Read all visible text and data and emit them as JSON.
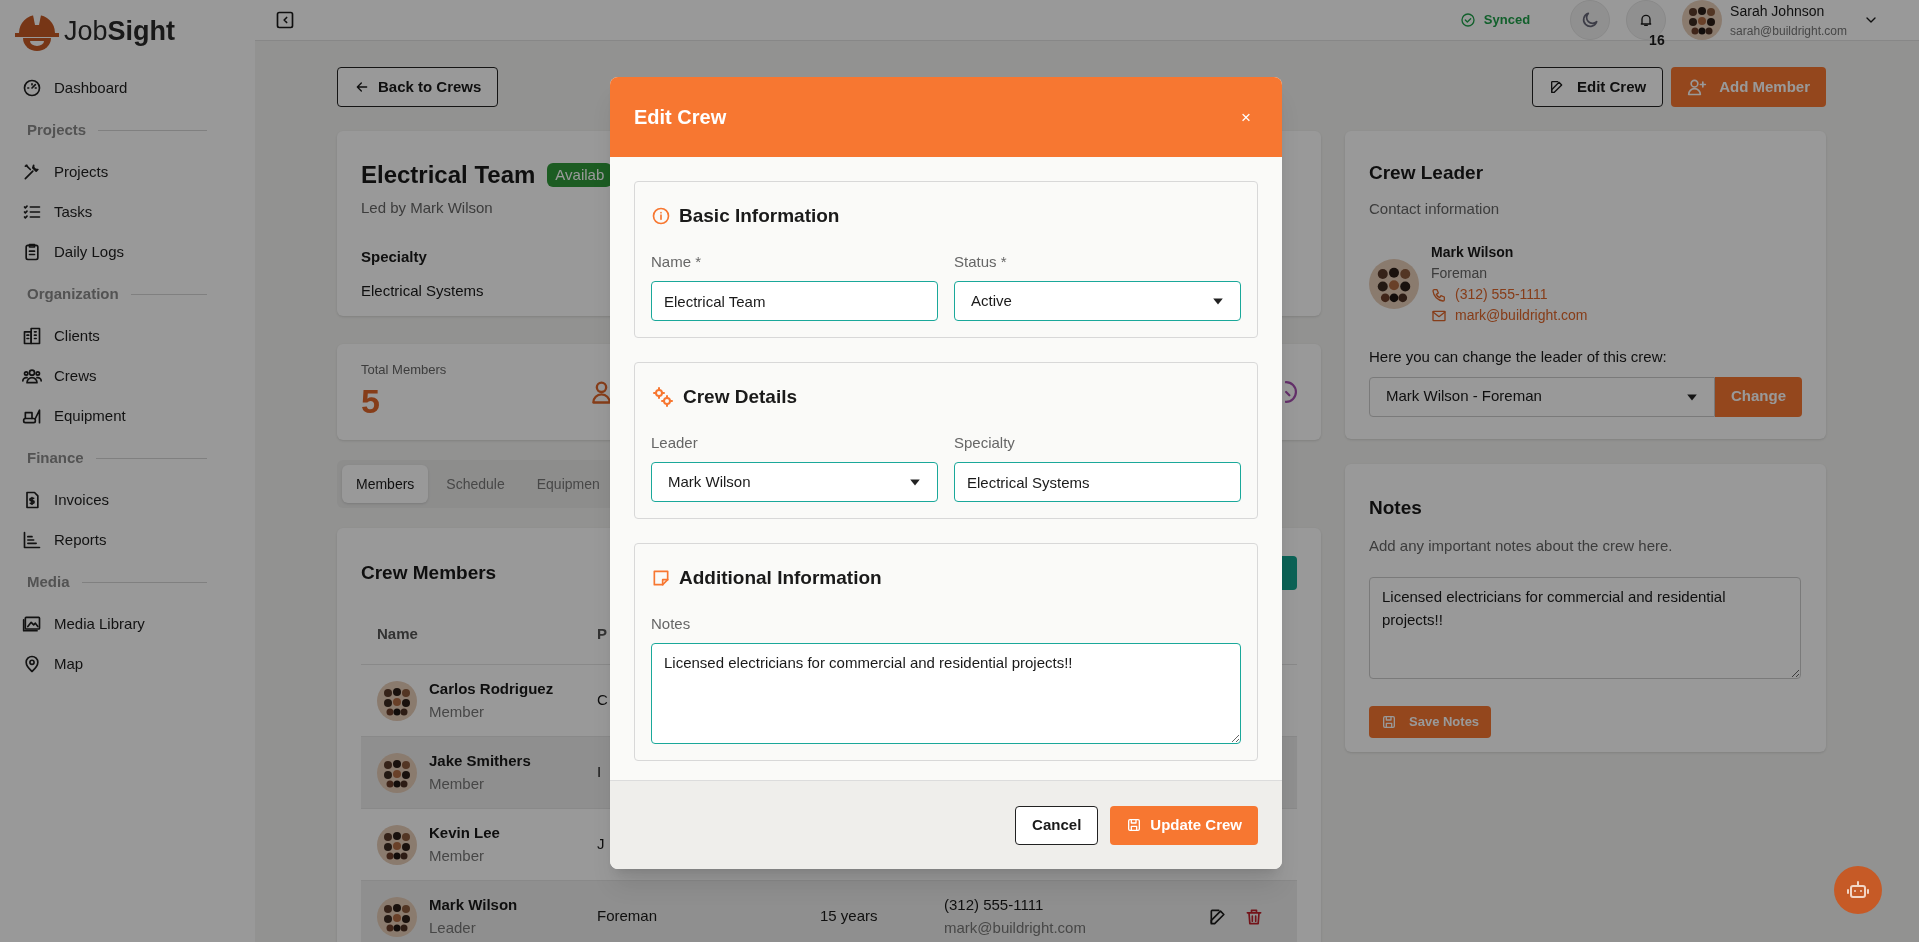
{
  "brand": {
    "name": "Job**Sight**"
  },
  "sidebar": {
    "items": [
      {
        "kind": "link",
        "label": "Dashboard"
      },
      {
        "kind": "heading",
        "label": "Projects"
      },
      {
        "kind": "link",
        "label": "Projects"
      },
      {
        "kind": "link",
        "label": "Tasks"
      },
      {
        "kind": "link",
        "label": "Daily Logs"
      },
      {
        "kind": "heading",
        "label": "Organization"
      },
      {
        "kind": "link",
        "label": "Clients"
      },
      {
        "kind": "link",
        "label": "Crews"
      },
      {
        "kind": "link",
        "label": "Equipment"
      },
      {
        "kind": "heading",
        "label": "Finance"
      },
      {
        "kind": "link",
        "label": "Invoices"
      },
      {
        "kind": "link",
        "label": "Reports"
      },
      {
        "kind": "heading",
        "label": "Media"
      },
      {
        "kind": "link",
        "label": "Media Library"
      },
      {
        "kind": "link",
        "label": "Map"
      }
    ]
  },
  "top_bar": {
    "sync_status": "Synced",
    "notification_count": "16",
    "user": {
      "name": "Sarah Johnson",
      "email": "sarah@buildright.com"
    }
  },
  "page": {
    "back_button": "Back to Crews",
    "actions": [
      "Edit Crew",
      "Add Member"
    ],
    "crew": {
      "name": "Electrical Team",
      "status_badge": "Availab",
      "led_by": "Led by Mark Wilson",
      "specialty_label": "Specialty",
      "specialty": "Electrical Systems"
    },
    "stats": {
      "label": "Total Members",
      "value": "5"
    },
    "tabs": [
      {
        "label": "Members",
        "selected": true
      },
      {
        "label": "Schedule",
        "selected": false
      },
      {
        "label": "Equipmen",
        "selected": false
      }
    ],
    "members": {
      "title": "Crew Members",
      "columns": [
        "Name",
        "P"
      ],
      "rows": [
        {
          "name": "Carlos Rodriguez",
          "role": "Member",
          "column_2": "C"
        },
        {
          "name": "Jake Smithers",
          "role": "Member",
          "column_2": "I"
        },
        {
          "name": "Kevin Lee",
          "role": "Member",
          "column_2": "J"
        },
        {
          "name": "Mark Wilson",
          "role": "Leader",
          "column_2": "Foreman",
          "column_3": "15 years",
          "phone": "(312) 555-1111",
          "email": "mark@buildright.com"
        }
      ]
    },
    "leader": {
      "title": "Crew Leader",
      "subtitle": "Contact information",
      "name": "Mark Wilson",
      "position": "Foreman",
      "phone": "(312) 555-1111",
      "email": "mark@buildright.com",
      "change_label": "Here you can change the leader of this crew:",
      "select_value": "Mark Wilson - Foreman",
      "change_button": "Change"
    },
    "notes": {
      "title": "Notes",
      "description": "Add any important notes about the crew here.",
      "value": "Licensed electricians for commercial and residential projects!!",
      "save_button": "Save Notes"
    }
  },
  "modal": {
    "title": "Edit Crew",
    "close": "×",
    "sections": [
      {
        "title": "Basic Information",
        "fields": [
          {
            "label": "Name *",
            "kind": "input",
            "value": "Electrical Team"
          },
          {
            "label": "Status *",
            "kind": "select",
            "value": "Active"
          }
        ]
      },
      {
        "title": "Crew Details",
        "fields": [
          {
            "label": "Leader",
            "kind": "select",
            "value": "Mark Wilson"
          },
          {
            "label": "Specialty",
            "kind": "input",
            "value": "Electrical Systems"
          }
        ]
      },
      {
        "title": "Additional Information",
        "fields": [
          {
            "label": "Notes",
            "kind": "textarea",
            "value": "Licensed electricians for commercial and residential projects!!"
          }
        ]
      }
    ],
    "cancel_button": "Cancel",
    "submit_button": "Update Crew"
  }
}
